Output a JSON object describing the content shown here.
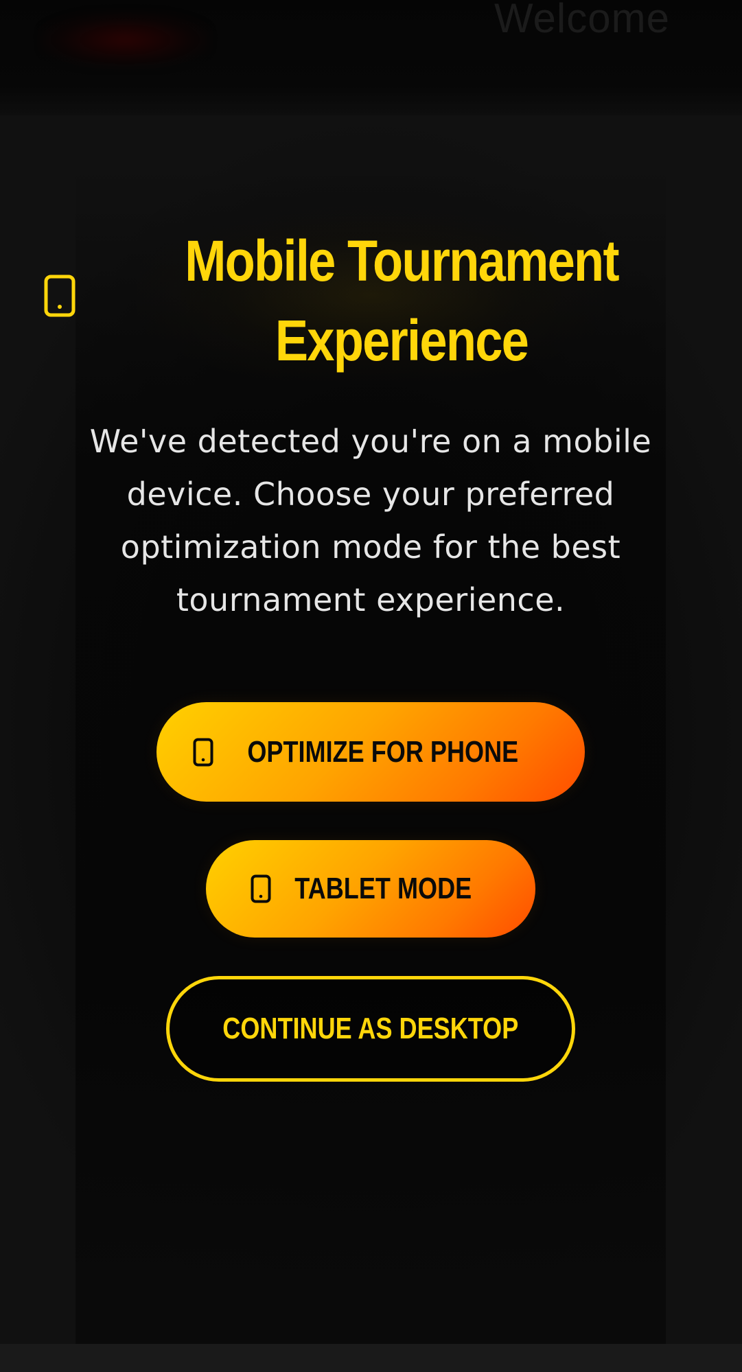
{
  "header": {
    "welcome_text": "Welcome"
  },
  "modal": {
    "icon": "tablet-icon",
    "title": "Mobile Tournament Experience",
    "description": "We've detected you're on a mobile device. Choose your preferred optimization mode for the best tournament experience."
  },
  "buttons": {
    "phone": {
      "label": "OPTIMIZE FOR PHONE",
      "icon": "phone-icon"
    },
    "tablet": {
      "label": "TABLET MODE",
      "icon": "tablet-icon"
    },
    "desktop": {
      "label": "CONTINUE AS DESKTOP"
    }
  },
  "colors": {
    "accent_yellow": "#ffd60a",
    "gradient_start": "#ffd000",
    "gradient_end": "#ff4c00",
    "background": "#111111",
    "text": "#e6e6e6"
  }
}
